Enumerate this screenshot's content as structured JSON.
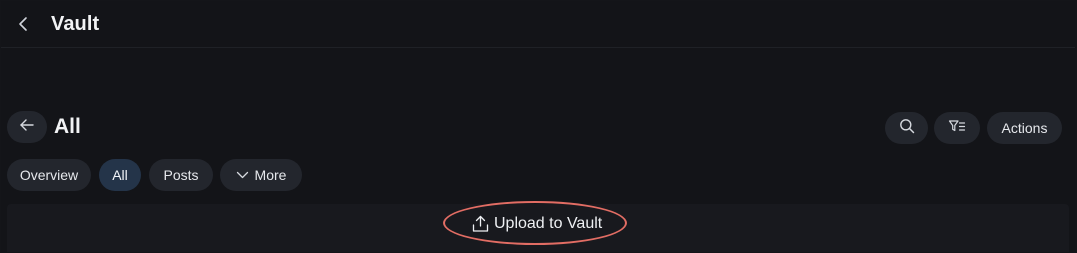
{
  "app": {
    "title": "Vault",
    "back_icon": "chevron-left-icon"
  },
  "page": {
    "title": "All",
    "back_icon": "arrow-left-icon"
  },
  "toolbar": {
    "search_icon": "search-icon",
    "filter_icon": "filter-icon",
    "actions_label": "Actions"
  },
  "tabs": [
    {
      "label": "Overview",
      "active": false
    },
    {
      "label": "All",
      "active": true
    },
    {
      "label": "Posts",
      "active": false
    },
    {
      "label": "More",
      "active": false,
      "icon": "chevron-down-icon"
    }
  ],
  "upload": {
    "label": "Upload to Vault",
    "icon": "upload-icon",
    "highlight_color": "#e26d64"
  },
  "colors": {
    "background": "#131418",
    "chip": "#23262d",
    "chip_active": "#243449",
    "text": "#e6e8ec"
  }
}
